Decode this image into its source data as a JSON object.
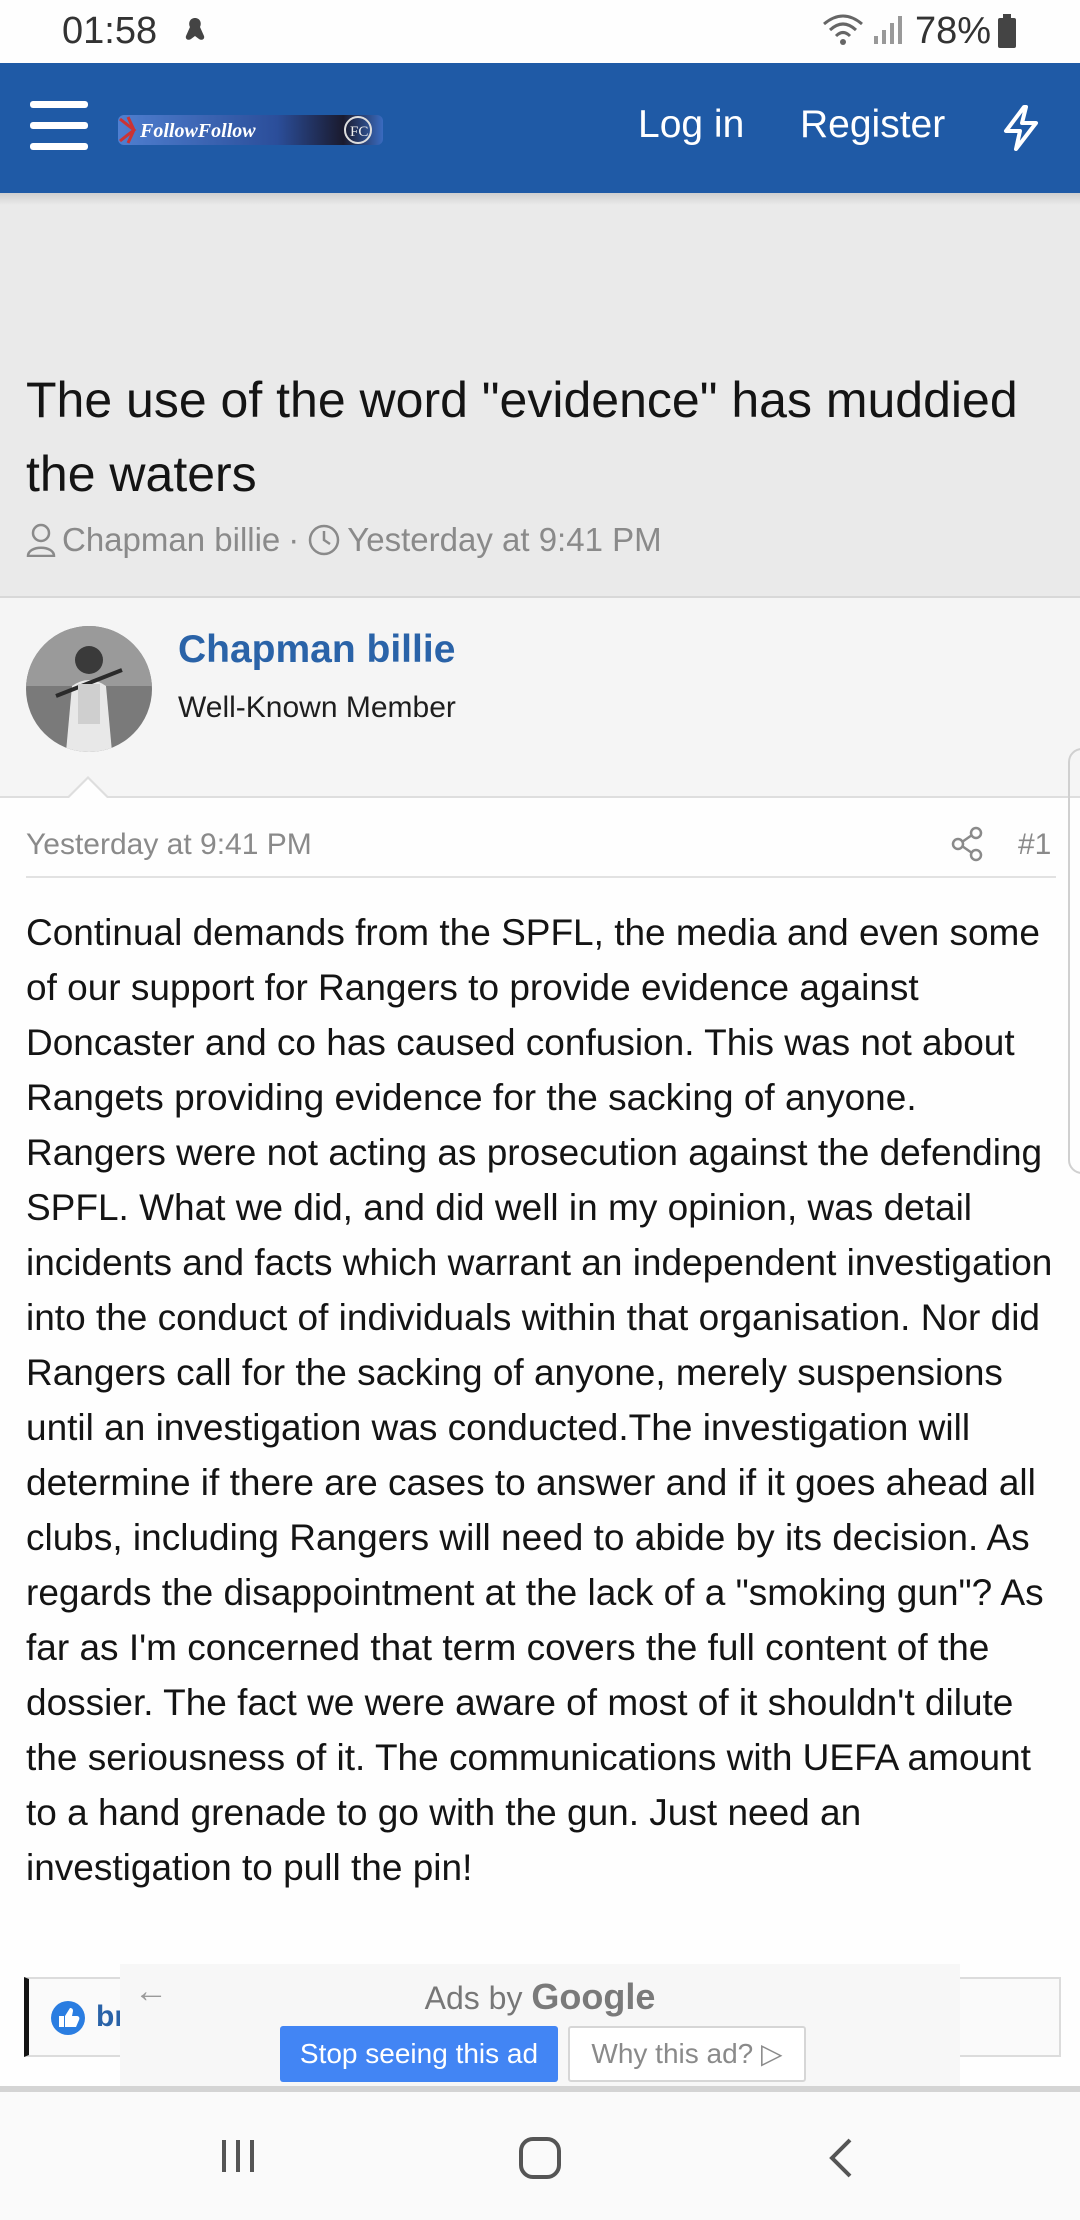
{
  "status_bar": {
    "time": "01:58",
    "battery": "78%",
    "icons": [
      "notification-icon",
      "wifi-icon",
      "signal-icon",
      "battery-icon"
    ]
  },
  "header": {
    "logo_text": "FollowFollow",
    "login_label": "Log in",
    "register_label": "Register",
    "icons": [
      "menu-icon",
      "bolt-icon"
    ],
    "background_color": "#1f5aa6"
  },
  "thread": {
    "title": "The use of the word \"evidence\" has muddied the waters",
    "author": "Chapman billie",
    "separator": "·",
    "date": "Yesterday at 9:41 PM"
  },
  "post": {
    "username": "Chapman billie",
    "user_title": "Well-Known Member",
    "date": "Yesterday at 9:41 PM",
    "number": "#1",
    "body": "Continual demands from the SPFL, the media and even some of our support for Rangers to provide evidence against Doncaster and co has caused confusion. This was not about Rangets providing evidence for the sacking of anyone. Rangers were not acting as prosecution against the defending SPFL. What we did, and did well in my opinion, was detail incidents and facts which warrant an independent investigation into the conduct of individuals within that organisation. Nor did Rangers call for the sacking of anyone, merely suspensions until an investigation was conducted.The investigation will determine if there are cases to answer and if it goes ahead all clubs, including Rangers will need to abide by its decision. As regards the disappointment at the lack of a \"smoking gun\"? As far as I'm concerned that term covers the full content of the dossier. The fact we were aware of most of it shouldn't dilute the seriousness of it. The communications with UEFA amount to a hand grenade to go with the gun. Just need an investigation to pull the pin!",
    "reaction_text": "br"
  },
  "ad": {
    "ads_by": "Ads by",
    "brand": "Google",
    "stop_label": "Stop seeing this ad",
    "why_label": "Why this ad? ▷",
    "back_glyph": "←",
    "accent_color": "#4285f4"
  },
  "nav_bar": {
    "icons": [
      "recent-apps-icon",
      "home-icon",
      "back-icon"
    ]
  }
}
